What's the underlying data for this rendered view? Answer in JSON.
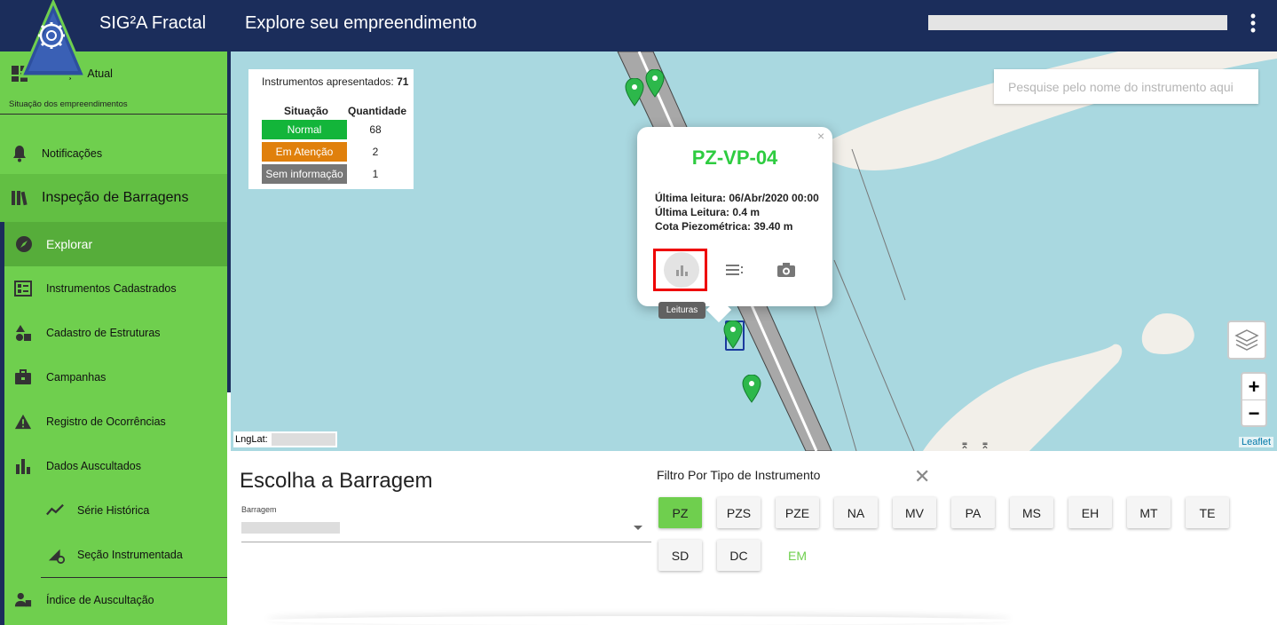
{
  "header": {
    "app_title": "SIG²A Fractal",
    "page_title": "Explore seu empreendimento"
  },
  "sidebar": {
    "situacao_atual": "Situação Atual",
    "situacao_caption": "Situação dos empreendimentos",
    "notificacoes": "Notificações",
    "inspecao": "Inspeção de Barragens",
    "explorar": "Explorar",
    "instrumentos": "Instrumentos Cadastrados",
    "cadastro_estruturas": "Cadastro de Estruturas",
    "campanhas": "Campanhas",
    "registro": "Registro de Ocorrências",
    "dados": "Dados Auscultados",
    "serie": "Série Histórica",
    "secao": "Seção Instrumentada",
    "indice": "Índice de Auscultação"
  },
  "legend": {
    "title_label": "Instrumentos apresentados:",
    "total": "71",
    "col_situacao": "Situação",
    "col_quantidade": "Quantidade",
    "rows": [
      {
        "label": "Normal",
        "qty": "68",
        "color": "#13b53a"
      },
      {
        "label": "Em Atenção",
        "qty": "2",
        "color": "#e0800c"
      },
      {
        "label": "Sem informação",
        "qty": "1",
        "color": "#777777"
      }
    ]
  },
  "search": {
    "placeholder": "Pesquise pelo nome do instrumento aqui"
  },
  "popup": {
    "title": "PZ-VP-04",
    "ultima_leitura_data": "Última leitura: 06/Abr/2020 00:00",
    "ultima_leitura_valor": "Última Leitura: 0.4 m",
    "cota": "Cota Piezométrica: 39.40 m",
    "tooltip": "Leituras",
    "close": "×"
  },
  "map": {
    "lnglat_label": "LngLat:",
    "zoom_in": "+",
    "zoom_out": "−",
    "attribution": "Leaflet"
  },
  "bottom": {
    "title": "Escolha a Barragem",
    "field_label": "Barragem",
    "filter_title": "Filtro Por Tipo de Instrumento",
    "filter_close": "✕",
    "chips": [
      "PZ",
      "PZS",
      "PZE",
      "NA",
      "MV",
      "PA",
      "MS",
      "EH",
      "MT",
      "TE",
      "SD",
      "DC",
      "EM"
    ]
  },
  "colors": {
    "header": "#1b2d5b",
    "sidebar": "#6fcf4e",
    "accent_green": "#2ecc40",
    "water": "#a9d8e0",
    "land": "#f2efe9"
  }
}
